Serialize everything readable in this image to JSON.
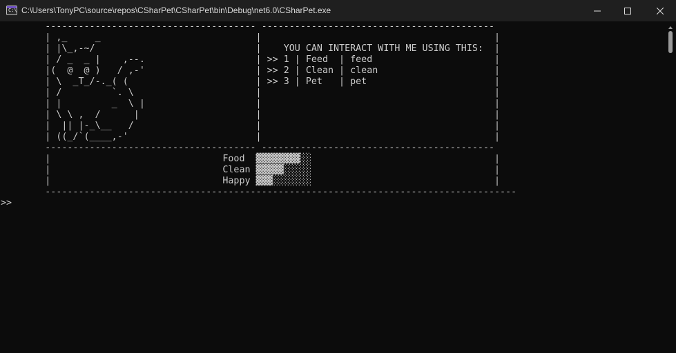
{
  "window": {
    "title": "C:\\Users\\TonyPC\\source\\repos\\CSharPet\\CSharPet\\bin\\Debug\\net6.0\\CSharPet.exe",
    "icon_text": "C:\\",
    "controls": [
      "minimize-icon",
      "maximize-icon",
      "close-icon"
    ]
  },
  "console": {
    "lines": [
      "        -------------------------------------- ------------------------------------------",
      "        | ,_     _                            |                                          |",
      "        | |\\_,-~/                             |    YOU CAN INTERACT WITH ME USING THIS:  |",
      "        | / _  _ |    ,--.                    | >> 1 | Feed  | feed                      |",
      "        |(  @  @ )   / ,-'                    | >> 2 | Clean | clean                     |",
      "        | \\  _T_/-._( (                       | >> 3 | Pet   | pet                       |",
      "        | /         `. \\                      |                                          |",
      "        | |         _  \\ |                    |                                          |",
      "        | \\ \\ ,  /      |                     |                                          |",
      "        |  || |-_\\__   /                      |                                          |",
      "        | ((_/`(____,-'                       |                                          |",
      "        -------------------------------------- ------------------------------------------",
      "        |                               Food  ▓▓▓▓▓▓▓▓░░                                 |",
      "        |                               Clean ▓▓▓▓▓░░░░░                                 |",
      "        |                               Happy ▓▓▓░░░░░░░                                 |",
      "        -------------------------------------------------------------------------------------",
      "",
      ">>"
    ]
  },
  "stats": {
    "Food": 0.8,
    "Clean": 0.5,
    "Happy": 0.3
  },
  "colors": {
    "background": "#0c0c0c",
    "text": "#cccccc",
    "titlebar": "#1f1f1f"
  }
}
